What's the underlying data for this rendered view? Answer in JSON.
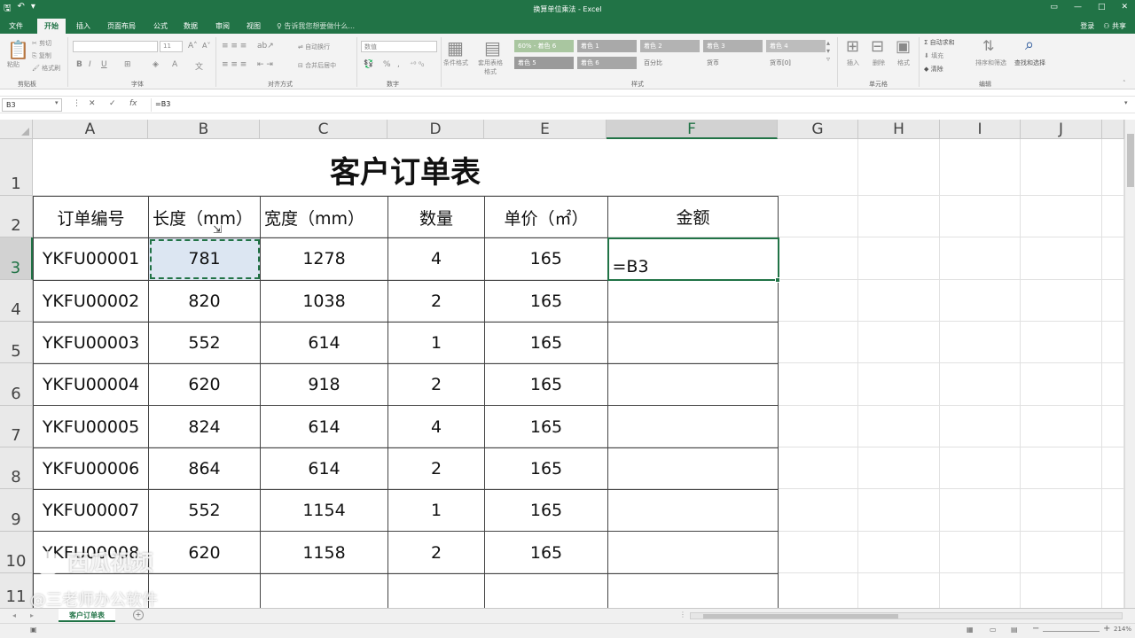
{
  "window": {
    "title": "换算单位乘法 - Excel",
    "qat_save": "🖫",
    "qat_undo": "↶",
    "qat_more": "▾",
    "min": "▭",
    "restore": "🗗",
    "maximize": "□",
    "close": "✕"
  },
  "tabs": [
    {
      "label": "文件"
    },
    {
      "label": "开始"
    },
    {
      "label": "插入"
    },
    {
      "label": "页面布局"
    },
    {
      "label": "公式"
    },
    {
      "label": "数据"
    },
    {
      "label": "审阅"
    },
    {
      "label": "视图"
    }
  ],
  "tell_me": "告诉我您想要做什么...",
  "account": {
    "login": "登录",
    "share": "共享"
  },
  "ribbon": {
    "clipboard": {
      "paste": "粘贴",
      "cut": "剪切",
      "copy": "复制",
      "format_painter": "格式刷",
      "label": "剪贴板"
    },
    "font": {
      "size": "11",
      "label": "字体",
      "bold": "B",
      "italic": "I",
      "underline": "U"
    },
    "alignment": {
      "wrap": "自动换行",
      "merge": "合并后居中",
      "label": "对齐方式"
    },
    "number": {
      "format": "数值",
      "percent": "%",
      "comma": ",",
      "label": "数字"
    },
    "styles": {
      "cond": "条件格式",
      "table": "套用表格格式",
      "label": "样式",
      "cells": [
        {
          "text": "60% - 着色 6",
          "color": "#a9c6a0"
        },
        {
          "text": "着色 1",
          "color": "#a9a9a9"
        },
        {
          "text": "着色 2",
          "color": "#b3b3b3"
        },
        {
          "text": "着色 3",
          "color": "#b0b0b0"
        },
        {
          "text": "着色 4",
          "color": "#bdbdbd"
        },
        {
          "text": "着色 5",
          "color": "#9a9a9a"
        },
        {
          "text": "着色 6",
          "color": "#a6a6a6"
        },
        {
          "text": "百分比",
          "color": "#f3f3f3"
        },
        {
          "text": "货币",
          "color": "#f3f3f3"
        },
        {
          "text": "货币[0]",
          "color": "#f3f3f3"
        }
      ]
    },
    "cells": {
      "insert": "插入",
      "delete": "删除",
      "format": "格式",
      "label": "单元格"
    },
    "editing": {
      "autosum": "自动求和",
      "fill": "填充",
      "clear": "清除",
      "sort": "排序和筛选",
      "find": "查找和选择",
      "label": "编辑"
    }
  },
  "formula_bar": {
    "name_box": "B3",
    "cancel": "✕",
    "enter": "✓",
    "fx": "fx",
    "formula": "=B3"
  },
  "columns": [
    "A",
    "B",
    "C",
    "D",
    "E",
    "F",
    "G",
    "H",
    "I",
    "J"
  ],
  "selected_column": "F",
  "rows": [
    "1",
    "2",
    "3",
    "4",
    "5",
    "6",
    "7",
    "8",
    "9",
    "10",
    "11"
  ],
  "selected_row": "3",
  "sheet": {
    "title": "客户订单表",
    "headers": [
      "订单编号",
      "长度（mm）",
      "宽度（mm）",
      "数量",
      "单价（㎡）",
      "金额"
    ],
    "rows": [
      [
        "YKFU00001",
        "781",
        "1278",
        "4",
        "165",
        "=B3"
      ],
      [
        "YKFU00002",
        "820",
        "1038",
        "2",
        "165",
        ""
      ],
      [
        "YKFU00003",
        "552",
        "614",
        "1",
        "165",
        ""
      ],
      [
        "YKFU00004",
        "620",
        "918",
        "2",
        "165",
        ""
      ],
      [
        "YKFU00005",
        "824",
        "614",
        "4",
        "165",
        ""
      ],
      [
        "YKFU00006",
        "864",
        "614",
        "2",
        "165",
        ""
      ],
      [
        "YKFU00007",
        "552",
        "1154",
        "1",
        "165",
        ""
      ],
      [
        "YKFU00008",
        "620",
        "1158",
        "2",
        "165",
        ""
      ]
    ]
  },
  "sheet_tabs": [
    {
      "label": "客户订单表"
    }
  ],
  "add_sheet": "+",
  "status": {
    "zoom": "214%"
  },
  "watermark": {
    "line1": "西瓜视频",
    "line2": "@三老师办公软件"
  }
}
